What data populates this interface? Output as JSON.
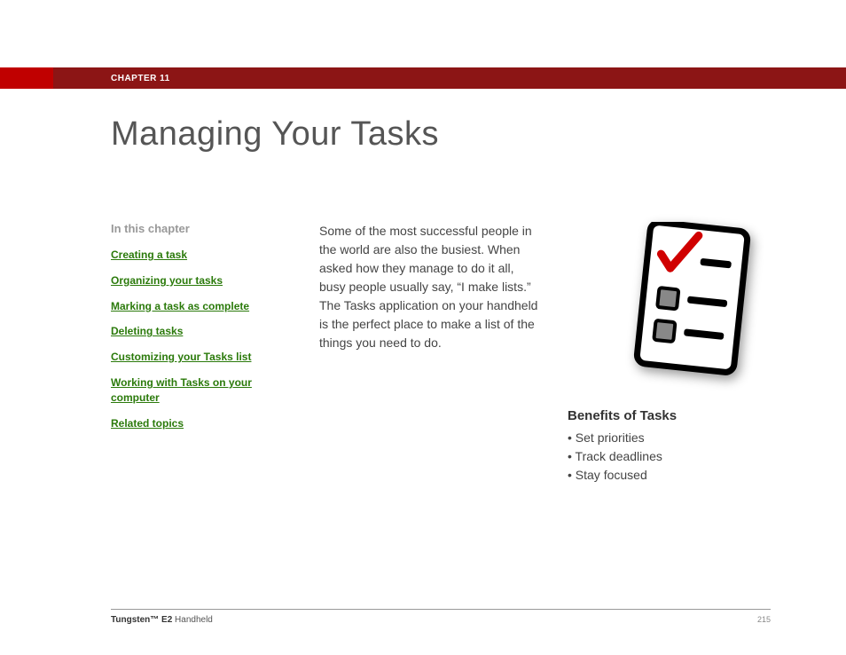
{
  "header": {
    "chapter": "CHAPTER 11"
  },
  "title": "Managing Your Tasks",
  "sidebar": {
    "heading": "In this chapter",
    "links": [
      "Creating a task",
      "Organizing your tasks",
      "Marking a task as complete",
      "Deleting tasks",
      "Customizing your Tasks list",
      "Working with Tasks on your computer",
      "Related topics"
    ]
  },
  "intro": "Some of the most successful people in the world are also the busiest. When asked how they manage to do it all, busy people usually say, “I make lists.” The Tasks application on your handheld is the perfect place to make a list of the things you need to do.",
  "benefits": {
    "heading": "Benefits of Tasks",
    "items": [
      "Set priorities",
      "Track deadlines",
      "Stay focused"
    ]
  },
  "footer": {
    "product_bold": "Tungsten™ E2",
    "product_rest": " Handheld",
    "page": "215"
  }
}
